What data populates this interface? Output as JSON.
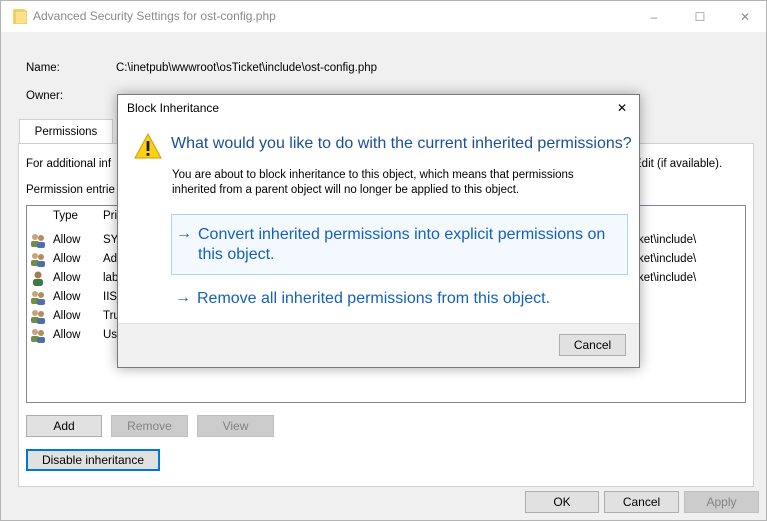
{
  "window": {
    "title": "Advanced Security Settings for ost-config.php",
    "minimize_glyph": "–",
    "maximize_glyph": "☐",
    "close_glyph": "✕"
  },
  "fields": {
    "name_label": "Name:",
    "name_value": "C:\\inetpub\\wwwroot\\osTicket\\include\\ost-config.php",
    "owner_label": "Owner:"
  },
  "tabs": [
    {
      "label": "Permissions"
    }
  ],
  "panel": {
    "info_prefix": "For additional inf",
    "info_suffix": "Edit (if available).",
    "entries_label": "Permission entrie"
  },
  "list": {
    "headers": {
      "type": "Type",
      "principal": "Pri"
    },
    "rows": [
      {
        "type": "Allow",
        "principal": "SYS",
        "applies": "ket\\include\\"
      },
      {
        "type": "Allow",
        "principal": "Ad",
        "applies": "ket\\include\\"
      },
      {
        "type": "Allow",
        "principal": "lab",
        "applies": "ket\\include\\"
      },
      {
        "type": "Allow",
        "principal": "IIS_",
        "applies": ""
      },
      {
        "type": "Allow",
        "principal": "Tru",
        "applies": ""
      },
      {
        "type": "Allow",
        "principal": "Use",
        "applies": ""
      }
    ]
  },
  "buttons": {
    "add": "Add",
    "remove": "Remove",
    "view": "View",
    "disable_inheritance": "Disable inheritance",
    "ok": "OK",
    "cancel": "Cancel",
    "apply": "Apply"
  },
  "dialog": {
    "title": "Block Inheritance",
    "close_glyph": "✕",
    "heading": "What would you like to do with the current inherited permissions?",
    "description": "You are about to block inheritance to this object, which means that permissions inherited from a parent object will no longer be applied to this object.",
    "option_convert": "Convert inherited permissions into explicit permissions on this object.",
    "option_remove": "Remove all inherited permissions from this object.",
    "arrow_glyph": "→",
    "cancel": "Cancel"
  },
  "colors": {
    "link_blue": "#1561b8",
    "heading_blue": "#1a4f9c",
    "focus_blue": "#0078d7",
    "warning_yellow": "#fcd116"
  }
}
